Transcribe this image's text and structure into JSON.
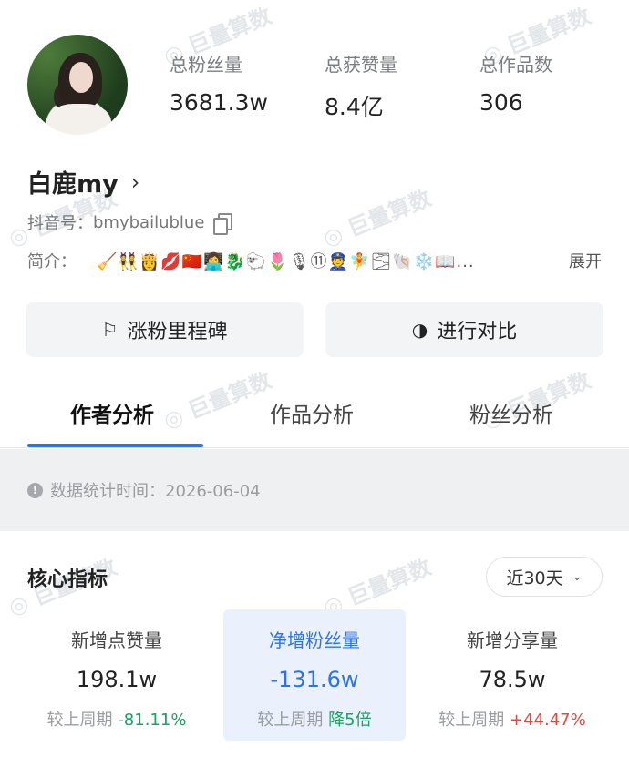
{
  "watermark": "巨量算数",
  "profile": {
    "stats": [
      {
        "label": "总粉丝量",
        "value": "3681.3w"
      },
      {
        "label": "总获赞量",
        "value": "8.4亿"
      },
      {
        "label": "总作品数",
        "value": "306"
      }
    ],
    "name": "白鹿my",
    "douyin_prefix": "抖音号：",
    "douyin_id": "bmybailublue",
    "bio_label": "简介：",
    "bio_emojis": "🧹👯👸💋🇨🇳👩‍💻🐉🐑🌷🎙⑪👮🧚🌫🐚❄️📖...",
    "bio_expand": "展开"
  },
  "actions": {
    "milestone": "涨粉里程碑",
    "compare": "进行对比"
  },
  "tabs": [
    "作者分析",
    "作品分析",
    "粉丝分析"
  ],
  "info_bar": {
    "text": "数据统计时间：2026-06-04"
  },
  "core": {
    "title": "核心指标",
    "range": "近30天",
    "metrics": [
      {
        "label": "新增点赞量",
        "value": "198.1w",
        "cmp_label": "较上周期",
        "cmp_value": "-81.11%",
        "cmp_color": "#1aa260"
      },
      {
        "label": "净增粉丝量",
        "value": "-131.6w",
        "cmp_label": "较上周期",
        "cmp_value": "降5倍",
        "cmp_color": "#1aa260"
      },
      {
        "label": "新增分享量",
        "value": "78.5w",
        "cmp_label": "较上周期",
        "cmp_value": "+44.47%",
        "cmp_color": "#e8453c"
      }
    ]
  },
  "colors": {
    "accent": "#2e73e6",
    "down_green": "#1aa260",
    "up_red": "#e8453c"
  }
}
